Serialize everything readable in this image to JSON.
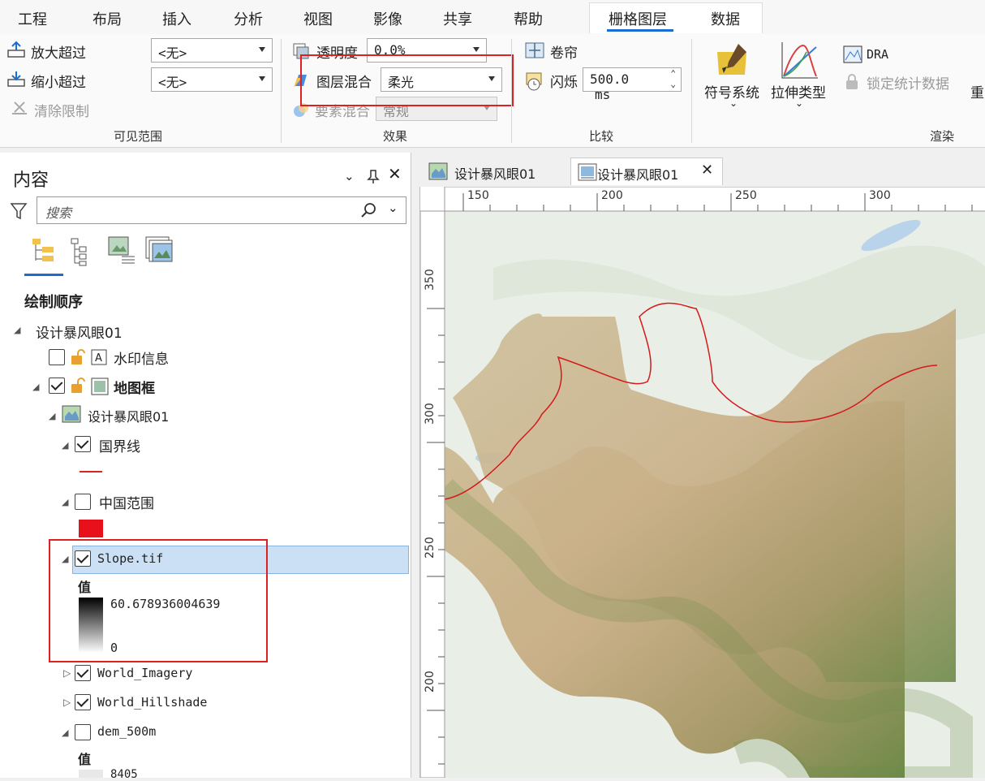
{
  "menubar": {
    "items": [
      "工程",
      "布局",
      "插入",
      "分析",
      "视图",
      "影像",
      "共享",
      "帮助"
    ],
    "context_tabs": [
      "栅格图层",
      "数据"
    ]
  },
  "ribbon": {
    "visible_range": {
      "zoom_in": "放大超过",
      "zoom_out": "缩小超过",
      "clear": "清除限制",
      "zoom_in_value": "<无>",
      "zoom_out_value": "<无>",
      "label": "可见范围"
    },
    "effects": {
      "transparency": "透明度",
      "transparency_value": "0.0%",
      "blend": "图层混合",
      "blend_value": "柔光",
      "feature_blend": "要素混合",
      "feature_blend_value": "常规",
      "label": "效果"
    },
    "compare": {
      "swipe": "卷帘",
      "flicker": "闪烁",
      "flicker_value": "500.0",
      "flicker_unit": "ms",
      "label": "比较"
    },
    "rendering": {
      "symbology": "符号系统",
      "stretch": "拉伸类型",
      "dra": "DRA",
      "lock_stats": "锁定统计数据",
      "more": "重",
      "label": "渲染"
    }
  },
  "panel": {
    "title": "内容",
    "search_placeholder": "搜索",
    "section": "绘制顺序",
    "map": "设计暴风眼01",
    "layers": {
      "watermark": "水印信息",
      "frame": "地图框",
      "mapframe": "设计暴风眼01",
      "boundary": "国界线",
      "china": "中国范围",
      "slope": "Slope.tif",
      "value_label": "值",
      "slope_max": "60.678936004639",
      "slope_min": "0",
      "imagery": "World_Imagery",
      "hillshade": "World_Hillshade",
      "dem": "dem_500m",
      "dem_value_label": "值",
      "dem_max": "8405"
    }
  },
  "map": {
    "tabs": [
      "设计暴风眼01",
      "设计暴风眼01"
    ],
    "ruler_top": [
      "150",
      "200",
      "250",
      "300"
    ],
    "ruler_left": [
      "350",
      "300",
      "250",
      "200"
    ]
  },
  "colors": {
    "accent": "#1b6ed1",
    "highlight_box": "#e02020",
    "selected_row": "#cce0f5"
  }
}
